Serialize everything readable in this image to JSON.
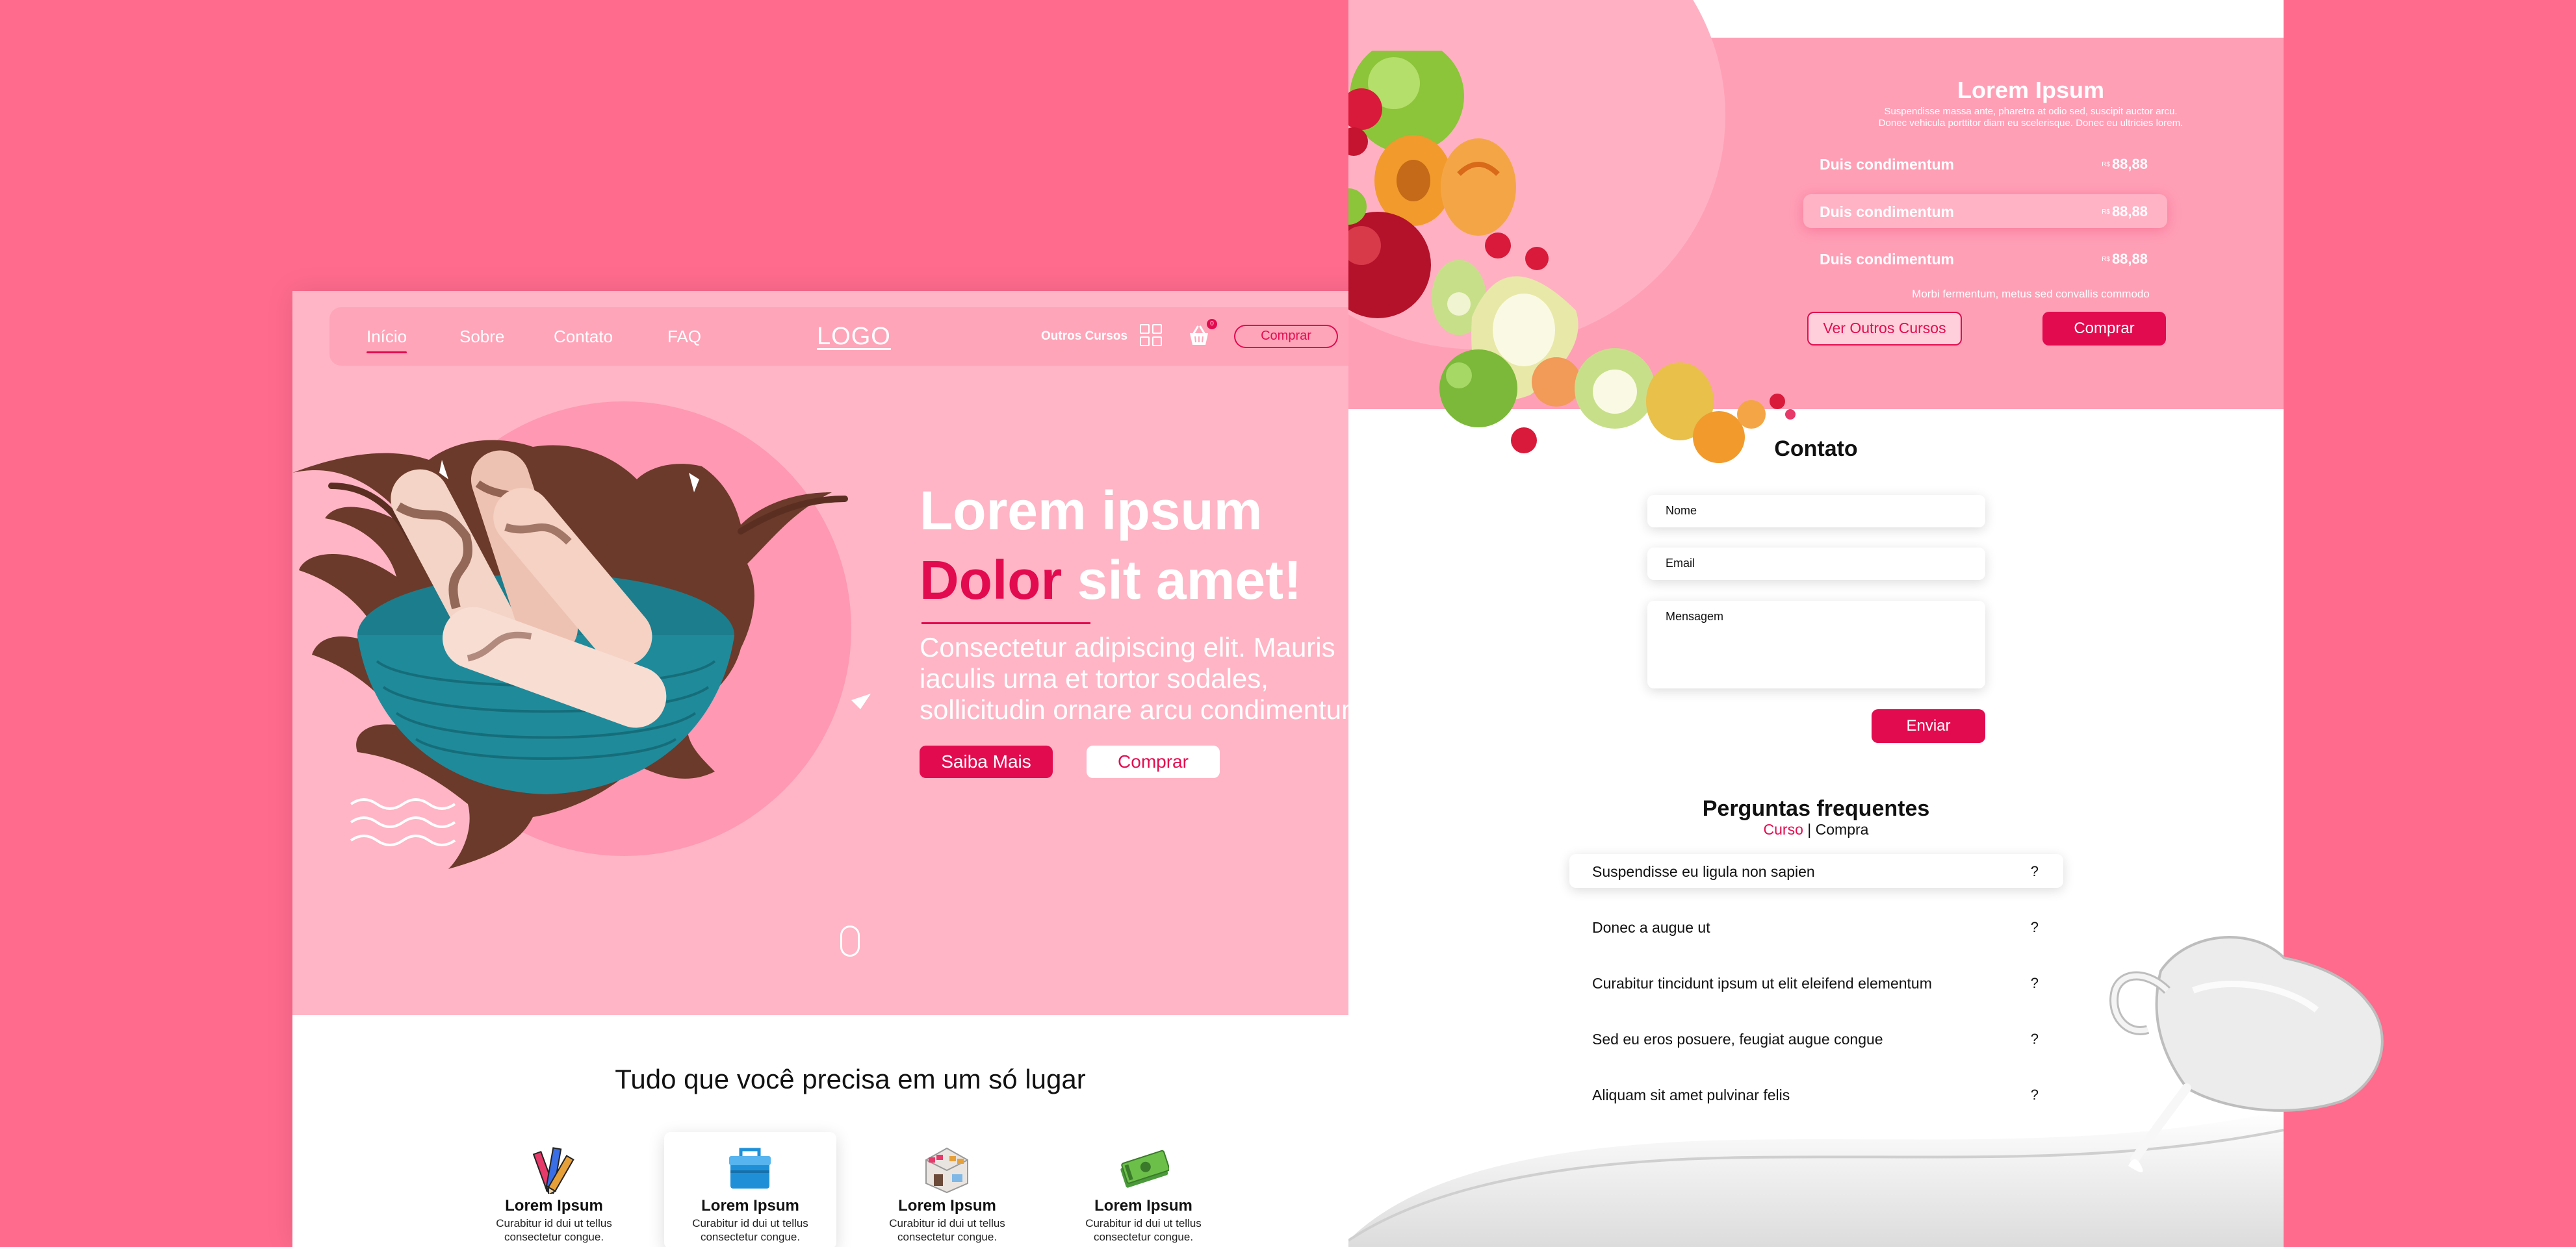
{
  "nav": {
    "links": [
      "Início",
      "Sobre",
      "Contato",
      "FAQ"
    ],
    "logo": "LOGO",
    "other_courses": "Outros Cursos",
    "cart_count": "0",
    "buy": "Comprar"
  },
  "hero": {
    "title_line1": "Lorem ipsum",
    "title_accent": "Dolor",
    "title_line2_rest": "sit amet!",
    "text": "Consectetur adipiscing elit. Mauris iaculis urna et tortor  sodales, sollicitudin ornare  arcu condimentum.",
    "btn_more": "Saiba Mais",
    "btn_buy": "Comprar"
  },
  "features": {
    "title": "Tudo que você precisa em um só lugar",
    "items": [
      {
        "title": "Lorem Ipsum",
        "text": "Curabitur id dui ut tellus consectetur congue.",
        "icon": "pencils-icon"
      },
      {
        "title": "Lorem Ipsum",
        "text": "Curabitur id dui ut tellus consectetur congue.",
        "icon": "cooler-box-icon"
      },
      {
        "title": "Lorem Ipsum",
        "text": "Curabitur id dui ut tellus consectetur congue.",
        "icon": "shop-icon"
      },
      {
        "title": "Lorem Ipsum",
        "text": "Curabitur id dui ut tellus consectetur congue.",
        "icon": "money-icon"
      }
    ]
  },
  "pricing": {
    "title": "Lorem Ipsum",
    "subtitle_1": "Suspendisse massa ante, pharetra at odio sed, suscipit auctor arcu.",
    "subtitle_2": "Donec vehicula porttitor diam eu scelerisque. Donec eu ultricies lorem.",
    "rows": [
      {
        "name": "Duis condimentum",
        "currency": "R$",
        "price": "88,88"
      },
      {
        "name": "Duis condimentum",
        "currency": "R$",
        "price": "88,88"
      },
      {
        "name": "Duis condimentum",
        "currency": "R$",
        "price": "88,88"
      }
    ],
    "note": "Morbi fermentum, metus sed convallis commodo",
    "btn_other": "Ver Outros Cursos",
    "btn_buy": "Comprar"
  },
  "contact": {
    "title": "Contato",
    "fields": [
      "Nome",
      "Email",
      "Mensagem"
    ],
    "submit": "Enviar"
  },
  "faq": {
    "title": "Perguntas frequentes",
    "tab_active": "Curso",
    "separator": "|",
    "tab_other": "Compra",
    "mark": "?",
    "items": [
      "Suspendisse eu ligula non sapien",
      "Donec a augue ut",
      "Curabitur tincidunt ipsum ut elit eleifend elementum",
      "Sed eu eros posuere, feugiat augue congue",
      "Aliquam sit amet pulvinar felis"
    ]
  },
  "colors": {
    "background": "#ff6b8d",
    "hero_bg": "#ffb5c5",
    "accent": "#e30b4f",
    "white": "#ffffff"
  }
}
